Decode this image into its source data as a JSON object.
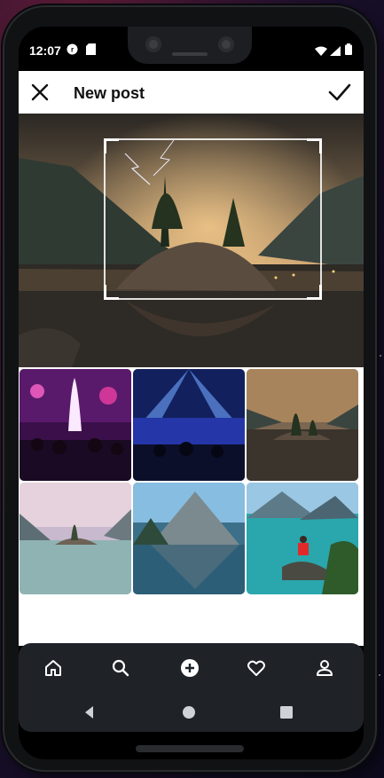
{
  "status_bar": {
    "time": "12:07",
    "icons": [
      "notification-badge-icon",
      "sd-card-icon",
      "wifi-icon",
      "signal-icon",
      "battery-icon"
    ]
  },
  "header": {
    "title": "New post",
    "close_icon": "close-icon",
    "confirm_icon": "check-icon"
  },
  "preview": {
    "image": "lake-island-lightning-photo"
  },
  "gallery": {
    "images": [
      "concert-crowd-pink-photo",
      "concert-stage-blue-lights-photo",
      "lake-island-lightning-photo",
      "lake-island-pastel-photo",
      "mountain-lake-reflection-photo",
      "turquoise-lake-person-photo"
    ]
  },
  "bottom_nav": {
    "items": [
      "home-icon",
      "search-icon",
      "add-icon",
      "heart-icon",
      "profile-icon"
    ]
  },
  "system_nav": {
    "items": [
      "back-icon",
      "home-button-icon",
      "recents-icon"
    ]
  },
  "colors": {
    "nav_background": "#1f2328",
    "header_background": "#ffffff",
    "accent": "#ffffff"
  }
}
